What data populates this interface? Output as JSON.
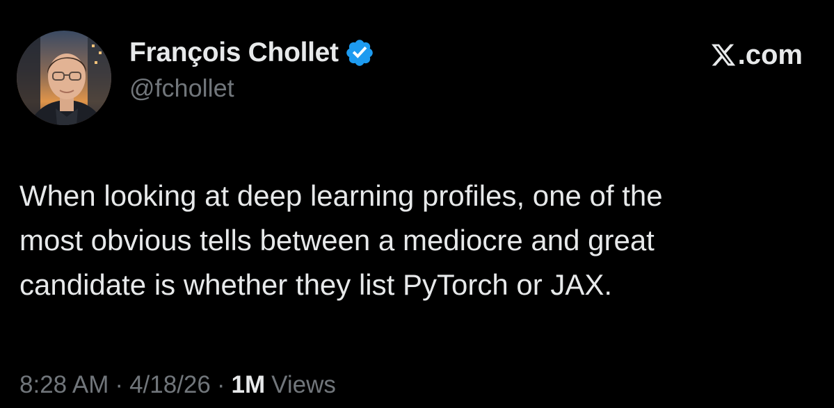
{
  "author": {
    "display_name": "François Chollet",
    "handle": "@fchollet",
    "verified": true,
    "verified_color": "#1d9bf0"
  },
  "site": {
    "logo_icon": "x-logo-icon",
    "label": ".com"
  },
  "tweet": {
    "lines": [
      "When looking at deep learning profiles, one of the",
      "most obvious tells between a mediocre and great",
      "candidate is whether they list PyTorch or JAX."
    ]
  },
  "meta": {
    "time": "8:28 AM",
    "separator": "·",
    "date": "4/18/26",
    "views_count": "1M",
    "views_label": "Views"
  },
  "colors": {
    "background": "#000000",
    "primary_text": "#e7e9ea",
    "secondary_text": "#71767b"
  }
}
